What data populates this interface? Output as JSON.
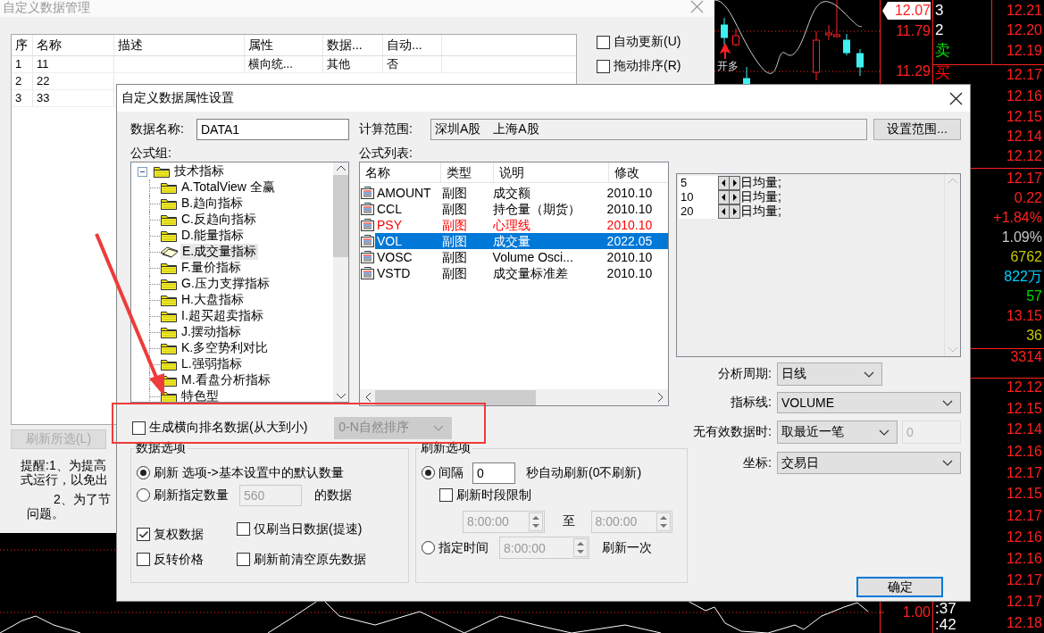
{
  "background_window": {
    "title": "自定义数据管理",
    "table": {
      "columns": [
        "序",
        "名称",
        "描述",
        "属性",
        "数据...",
        "自动..."
      ],
      "rows": [
        {
          "cells": [
            "1",
            "11",
            "",
            "横向统...",
            "其他",
            "否"
          ]
        },
        {
          "cells": [
            "2",
            "22"
          ]
        },
        {
          "cells": [
            "3",
            "33"
          ]
        }
      ]
    },
    "options": [
      {
        "label": "自动更新(U)",
        "checked": false
      },
      {
        "label": "拖动排序(R)",
        "checked": false
      }
    ],
    "refresh_button": {
      "label": "刷新所选(L)",
      "disabled": true
    },
    "notice_lines": [
      "提醒:1、为提高",
      "式运行，以免出",
      "2、为了节",
      "问题。"
    ]
  },
  "chart": {
    "marker_label": "开多"
  },
  "quote_panel": {
    "price_axis": [
      {
        "text": "12.07",
        "current": true
      },
      {
        "text": "11.79",
        "current": false
      },
      {
        "text": "11.29",
        "current": false
      },
      {
        "text": "1.00",
        "current": false
      }
    ],
    "labels": [
      {
        "text": "3",
        "color": "#ffffff"
      },
      {
        "text": "2",
        "color": "#ffffff"
      },
      {
        "text": "卖",
        "color": "#00e000"
      },
      {
        "text": "买",
        "color": "#ff0000"
      },
      {
        "text": ":37",
        "color": "#ffffff"
      },
      {
        "text": ":42",
        "color": "#ffffff"
      }
    ],
    "values": [
      {
        "text": "12.21",
        "color": "#ff2020"
      },
      {
        "text": "12.20",
        "color": "#ff2020"
      },
      {
        "text": "12.19",
        "color": "#ff2020"
      },
      {
        "text": "12.17",
        "color": "#ff2020"
      },
      {
        "text": "12.16",
        "color": "#ff2020"
      },
      {
        "text": "12.15",
        "color": "#ff2020"
      },
      {
        "text": "12.14",
        "color": "#ff2020"
      },
      {
        "text": "12.12",
        "color": "#ff2020"
      },
      {
        "text": "12.17",
        "color": "#ff2020"
      },
      {
        "text": "0.22",
        "color": "#ff2020"
      },
      {
        "text": "+1.84%",
        "color": "#ff2020"
      },
      {
        "text": "1.09%",
        "color": "#c8c8c8"
      },
      {
        "text": "6762",
        "color": "#c8c800"
      },
      {
        "text": "822万",
        "color": "#00d0ff"
      },
      {
        "text": "57",
        "color": "#00e000"
      },
      {
        "text": "13.15",
        "color": "#ff2020"
      },
      {
        "text": "36",
        "color": "#c8c800"
      },
      {
        "text": "3314",
        "color": "#ff2020"
      },
      {
        "text": "12.12",
        "color": "#ff2020"
      },
      {
        "text": "12.15",
        "color": "#ff2020"
      },
      {
        "text": "12.14",
        "color": "#ff2020"
      },
      {
        "text": "12.16",
        "color": "#ff2020"
      },
      {
        "text": "12.17",
        "color": "#ff2020"
      },
      {
        "text": "12.15",
        "color": "#ff2020"
      },
      {
        "text": "12.17",
        "color": "#ff2020"
      },
      {
        "text": "12.16",
        "color": "#ff2020"
      },
      {
        "text": "12.16",
        "color": "#ff2020"
      },
      {
        "text": "12.17",
        "color": "#ff2020"
      },
      {
        "text": "12.17",
        "color": "#ff2020"
      },
      {
        "text": "12.18",
        "color": "#ff2020"
      }
    ]
  },
  "dialog": {
    "title": "自定义数据属性设置",
    "data_name": {
      "label": "数据名称:",
      "value": "DATA1"
    },
    "calc_range": {
      "label": "计算范围:",
      "value": "深圳A股　上海A股",
      "button": "设置范围..."
    },
    "formula_group": {
      "label": "公式组:",
      "tree": [
        {
          "label": "技术指标",
          "expanded": true,
          "selected": false,
          "children": [
            {
              "label": "A.TotalView 全赢",
              "selected": false
            },
            {
              "label": "B.趋向指标",
              "selected": false
            },
            {
              "label": "C.反趋向指标",
              "selected": false
            },
            {
              "label": "D.能量指标",
              "selected": false
            },
            {
              "label": "E.成交量指标",
              "selected": true
            },
            {
              "label": "F.量价指标",
              "selected": false
            },
            {
              "label": "G.压力支撑指标",
              "selected": false
            },
            {
              "label": "H.大盘指标",
              "selected": false
            },
            {
              "label": "I.超买超卖指标",
              "selected": false
            },
            {
              "label": "J.摆动指标",
              "selected": false
            },
            {
              "label": "K.多空势利对比",
              "selected": false
            },
            {
              "label": "L.强弱指标",
              "selected": false
            },
            {
              "label": "M.看盘分析指标",
              "selected": false
            },
            {
              "label": "特色型",
              "selected": false
            }
          ]
        }
      ]
    },
    "formula_list": {
      "label": "公式列表:",
      "columns": [
        "名称",
        "类型",
        "说明",
        "修改"
      ],
      "rows": [
        {
          "cells": [
            "AMOUNT",
            "副图",
            "成交额",
            "2010.10"
          ],
          "color": "#000000",
          "selected": false
        },
        {
          "cells": [
            "CCL",
            "副图",
            "持仓量（期货）",
            "2010.10"
          ],
          "color": "#000000",
          "selected": false
        },
        {
          "cells": [
            "PSY",
            "副图",
            "心理线",
            "2010.10"
          ],
          "color": "#ff0000",
          "selected": false
        },
        {
          "cells": [
            "VOL",
            "副图",
            "成交量",
            "2022.05"
          ],
          "selected": true
        },
        {
          "cells": [
            "VOSC",
            "副图",
            "Volume Osci...",
            "2010.10"
          ],
          "color": "#000000",
          "selected": false
        },
        {
          "cells": [
            "VSTD",
            "副图",
            "成交量标准差",
            "2010.10"
          ],
          "color": "#000000",
          "selected": false
        }
      ]
    },
    "params": [
      {
        "value": "5",
        "label": "日均量;"
      },
      {
        "value": "10",
        "label": "日均量;"
      },
      {
        "value": "20",
        "label": "日均量;"
      }
    ],
    "settings": [
      {
        "label": "分析周期:",
        "value": "日线"
      },
      {
        "label": "指标线:",
        "value": "VOLUME"
      },
      {
        "label": "无有效数据时:",
        "value": "取最近一笔",
        "extra": {
          "value": "0",
          "disabled": true
        }
      },
      {
        "label": "坐标:",
        "value": "交易日"
      }
    ],
    "ranking": {
      "label": "生成横向排名数据(从大到小)",
      "checked": false,
      "sort": {
        "value": "0-N自然排序",
        "disabled": true
      }
    },
    "data_options": {
      "title": "数据选项",
      "items": [
        {
          "kind": "radio",
          "label": "刷新 选项->基本设置中的默认数量",
          "selected": true
        },
        {
          "kind": "radio",
          "label": "刷新指定数量",
          "selected": false,
          "field": {
            "value": "560",
            "disabled": true
          },
          "suffix": "的数据"
        },
        {
          "kind": "checkbox",
          "label": "复权数据",
          "checked": true
        },
        {
          "kind": "checkbox",
          "label": "仅刷当日数据(提速)",
          "checked": false
        },
        {
          "kind": "checkbox",
          "label": "反转价格",
          "checked": false
        },
        {
          "kind": "checkbox",
          "label": "刷新前清空原先数据",
          "checked": false
        }
      ]
    },
    "refresh_options": {
      "title": "刷新选项",
      "items": [
        {
          "kind": "radio",
          "label": "间隔",
          "selected": true,
          "field": {
            "value": "0",
            "disabled": false
          },
          "suffix": "秒自动刷新(0不刷新)"
        },
        {
          "kind": "checkbox",
          "label": "刷新时段限制",
          "checked": false
        },
        {
          "kind": "time_range",
          "from": {
            "value": "8:00:00",
            "disabled": true
          },
          "separator": "至",
          "to": {
            "value": "8:00:00",
            "disabled": true
          }
        },
        {
          "kind": "radio",
          "label": "指定时间",
          "selected": false,
          "time": {
            "value": "8:00:00",
            "disabled": true
          },
          "suffix": "刷新一次"
        }
      ]
    },
    "ok_button": "确定"
  }
}
